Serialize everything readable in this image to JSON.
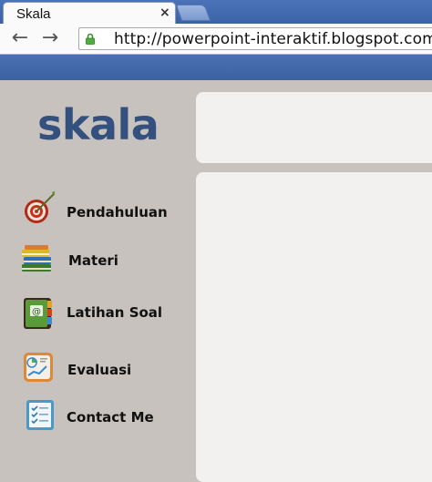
{
  "browser": {
    "tab_title": "Skala",
    "tab_close": "×",
    "back": "←",
    "forward": "→",
    "url": "http://powerpoint-interaktif.blogspot.com/"
  },
  "site": {
    "logo": "skala"
  },
  "sidebar": {
    "items": [
      {
        "label": "Pendahuluan",
        "icon": "target-dart-icon"
      },
      {
        "label": "Materi",
        "icon": "books-icon"
      },
      {
        "label": "Latihan Soal",
        "icon": "address-book-icon"
      },
      {
        "label": "Evaluasi",
        "icon": "chart-report-icon"
      },
      {
        "label": "Contact Me",
        "icon": "checklist-icon"
      }
    ]
  },
  "colors": {
    "logo": "#34507e",
    "sidebar_bg": "#c7c2bd",
    "panel_bg": "#f3f1ef",
    "browser_blue": "#3d62a4"
  }
}
